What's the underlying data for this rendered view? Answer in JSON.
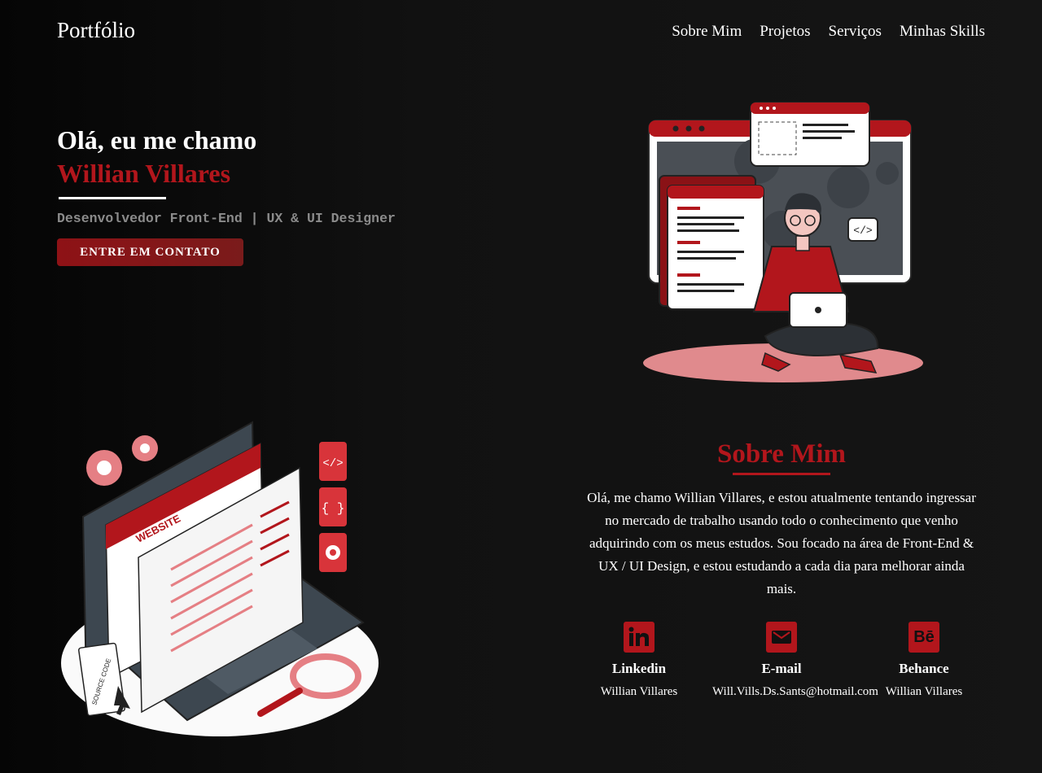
{
  "header": {
    "brand": "Portfólio",
    "nav": [
      "Sobre Mim",
      "Projetos",
      "Serviços",
      "Minhas Skills"
    ]
  },
  "hero": {
    "greeting": "Olá, eu me chamo",
    "name": "Willian Villares",
    "role": "Desenvolvedor Front-End | UX & UI Designer",
    "cta": "ENTRE EM CONTATO"
  },
  "about": {
    "title": "Sobre Mim",
    "text": "Olá, me chamo Willian Villares, e estou atualmente tentando ingressar no mercado de trabalho usando todo o conhecimento que venho adquirindo com os meus estudos. Sou focado na área de Front-End & UX / UI Design, e estou estudando a cada dia para melhorar ainda mais."
  },
  "contacts": [
    {
      "icon": "linkedin-icon",
      "label": "Linkedin",
      "value": "Willian Villares"
    },
    {
      "icon": "email-icon",
      "label": "E-mail",
      "value": "Will.Vills.Ds.Sants@hotmail.com"
    },
    {
      "icon": "behance-icon",
      "label": "Behance",
      "value": "Willian Villares"
    }
  ],
  "illustration": {
    "laptop_screen_text": "WEBSITE",
    "document_text": "SOURCE CODE"
  },
  "colors": {
    "accent": "#b2161c",
    "background": "#111111",
    "text": "#ffffff"
  }
}
